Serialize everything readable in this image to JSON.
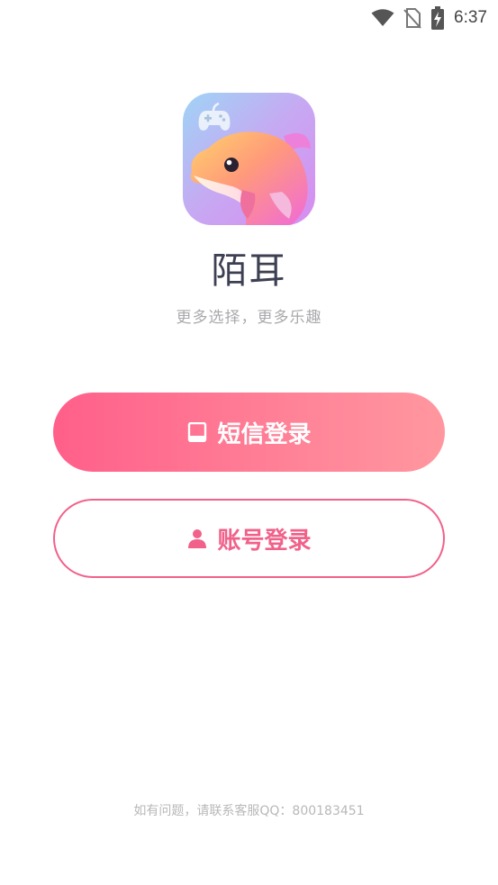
{
  "status_bar": {
    "time": "6:37",
    "icons": [
      "wifi-icon",
      "no-sim-icon",
      "battery-charging-icon"
    ]
  },
  "app": {
    "name": "陌耳",
    "slogan": "更多选择，更多乐趣",
    "logo": "dolphin-gamepad-logo"
  },
  "buttons": {
    "sms_login_label": "短信登录",
    "sms_login_icon": "tablet-icon",
    "account_login_label": "账号登录",
    "account_login_icon": "user-icon"
  },
  "footer": {
    "contact_text": "如有问题，请联系客服QQ：800183451"
  },
  "colors": {
    "accent": "#f1618a",
    "gradient_start": "#ff5f8a",
    "gradient_end": "#ff979f",
    "title": "#3d3f52",
    "muted": "#a9a9ad"
  }
}
